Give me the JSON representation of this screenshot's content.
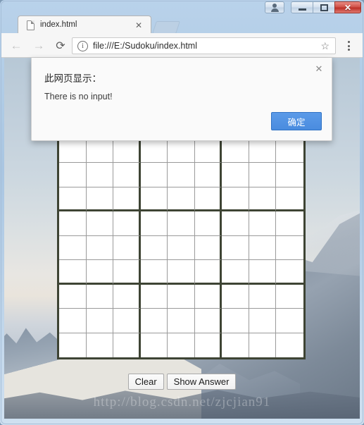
{
  "window": {
    "controls": {
      "user_label": "user-account",
      "minimize_label": "Minimize",
      "maximize_label": "Restore",
      "close_label": "✕"
    }
  },
  "tabstrip": {
    "tab": {
      "title": "index.html",
      "close_label": "✕",
      "icon": "page-icon"
    },
    "new_tab_label": "+"
  },
  "toolbar": {
    "back_label": "←",
    "forward_label": "→",
    "reload_label": "⟳",
    "info_label": "i",
    "url": "file:///E:/Sudoku/index.html",
    "star_label": "☆",
    "menu_label": "⋮"
  },
  "page": {
    "buttons": [
      {
        "label": "Clear",
        "name": "clear-button"
      },
      {
        "label": "Show Answer",
        "name": "show-answer-button"
      }
    ],
    "watermark": "http://blog.csdn.net/zjcjian91",
    "sudoku": {
      "rows": 9,
      "columns": 9,
      "values": [
        [
          "",
          "",
          "",
          "",
          "",
          "",
          "",
          "",
          ""
        ],
        [
          "",
          "",
          "",
          "",
          "",
          "",
          "",
          "",
          ""
        ],
        [
          "",
          "",
          "",
          "",
          "",
          "",
          "",
          "",
          ""
        ],
        [
          "",
          "",
          "",
          "",
          "",
          "",
          "",
          "",
          ""
        ],
        [
          "",
          "",
          "",
          "",
          "",
          "",
          "",
          "",
          ""
        ],
        [
          "",
          "",
          "",
          "",
          "",
          "",
          "",
          "",
          ""
        ],
        [
          "",
          "",
          "",
          "",
          "",
          "",
          "",
          "",
          ""
        ],
        [
          "",
          "",
          "",
          "",
          "",
          "",
          "",
          "",
          ""
        ],
        [
          "",
          "",
          "",
          "",
          "",
          "",
          "",
          "",
          ""
        ]
      ]
    }
  },
  "dialog": {
    "title": "此网页显示：",
    "message": "There is no input!",
    "ok_label": "确定",
    "close_label": "✕",
    "accent_color": "#4a8cdf"
  }
}
